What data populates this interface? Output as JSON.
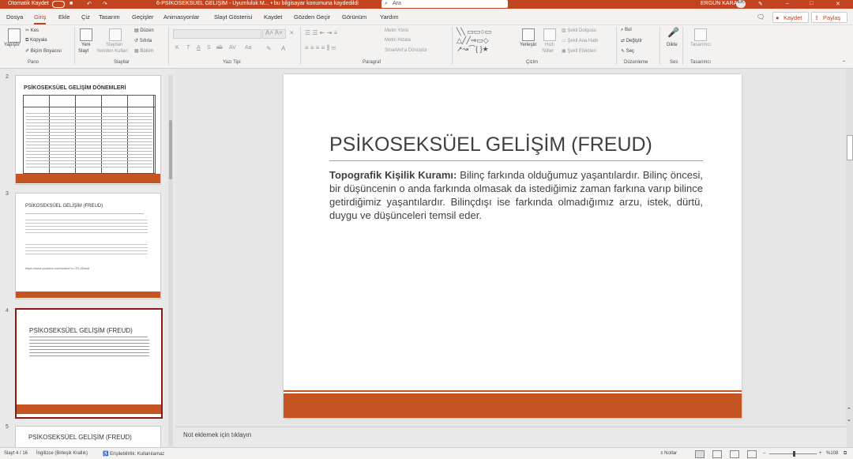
{
  "titlebar": {
    "autosave": "Otomatik Kaydet",
    "doc_title": "6-PSİKOSEKSÜEL GELİŞİM - Uyumluluk M... • bu bilgisayar konumuna kaydedildi",
    "search": "Ara",
    "user": "ERGÜN KARA"
  },
  "menu": {
    "tabs": [
      "Dosya",
      "Giriş",
      "Ekle",
      "Çiz",
      "Tasarım",
      "Geçişler",
      "Animasyonlar",
      "Slayt Gösterisi",
      "Kaydet",
      "Gözden Geçir",
      "Görünüm",
      "Yardım"
    ],
    "save": "Kaydet",
    "share": "Paylaş"
  },
  "ribbon": {
    "clipboard": {
      "paste": "Yapıştır",
      "cut": "Kes",
      "copy": "Kopyala",
      "format_painter": "Biçim Boyacısı",
      "group": "Pano"
    },
    "slides": {
      "new_slide": "Yeni",
      "new_slide2": "Slayt",
      "reuse": "Slaytları",
      "reuse2": "Yeniden Kullan",
      "layout": "Düzen",
      "reset": "Sıfırla",
      "section": "Bölüm",
      "group": "Slaytlar"
    },
    "font": {
      "group": "Yazı Tipi",
      "buttons": [
        "K",
        "T",
        "A",
        "S",
        "ab",
        "AV",
        "Aa"
      ]
    },
    "paragraph": {
      "text_dir": "Metin Yönü",
      "align_text": "Metni Hizala",
      "smartart": "SmartArt'a Dönüştür",
      "group": "Paragraf"
    },
    "drawing": {
      "arrange": "Yerleştir",
      "quick_styles": "Hızlı",
      "quick_styles2": "Stiller",
      "fill": "Şekil Dolgusu",
      "outline": "Şekil Ana Hattı",
      "effects": "Şekil Efektleri",
      "group": "Çizim"
    },
    "editing": {
      "find": "Bul",
      "replace": "Değiştir",
      "select": "Seç",
      "group": "Düzenleme"
    },
    "voice": {
      "dictate": "Dikte",
      "group": "Ses"
    },
    "designer": {
      "label": "Tasarımcı",
      "group": "Tasarımcı"
    }
  },
  "thumbnails": [
    {
      "number": "2",
      "title": "PSİKOSEKSÜEL GELİŞİM DÖNEMLERİ"
    },
    {
      "number": "3",
      "title": "PSİKOSEKSÜEL GELİŞİM (FREUD)",
      "link": "https://www.youtube.com/watch?v=JTI-dZwx8"
    },
    {
      "number": "4",
      "title": "PSİKOSEKSÜEL GELİŞİM (FREUD)"
    },
    {
      "number": "5",
      "title": "PSİKOSEKSÜEL GELİŞİM (FREUD)"
    }
  ],
  "slide": {
    "title": "PSİKOSEKSÜEL GELİŞİM (FREUD)",
    "body_bold": "Topografik Kişilik Kuramı:",
    "body_text": " Bilinç farkında olduğumuz yaşantılardır. Bilinç öncesi, bir düşüncenin o anda farkında olmasak da istediğimiz zaman farkına varıp bilince getirdiğimiz yaşantılardır. Bilinçdışı ise farkında olmadığımız arzu, istek, dürtü, duygu ve düşünceleri temsil eder."
  },
  "notes": {
    "placeholder": "Not eklemek için tıklayın"
  },
  "status": {
    "slide_count": "Slayt 4 / 16",
    "language": "İngilizce (Birleşik Krallık)",
    "accessibility": "Erişilebilirlik: Kullanılamaz",
    "notes": "Notlar",
    "zoom": "%108"
  },
  "colors": {
    "accent": "#c24320",
    "slide_bar": "#c55423"
  }
}
